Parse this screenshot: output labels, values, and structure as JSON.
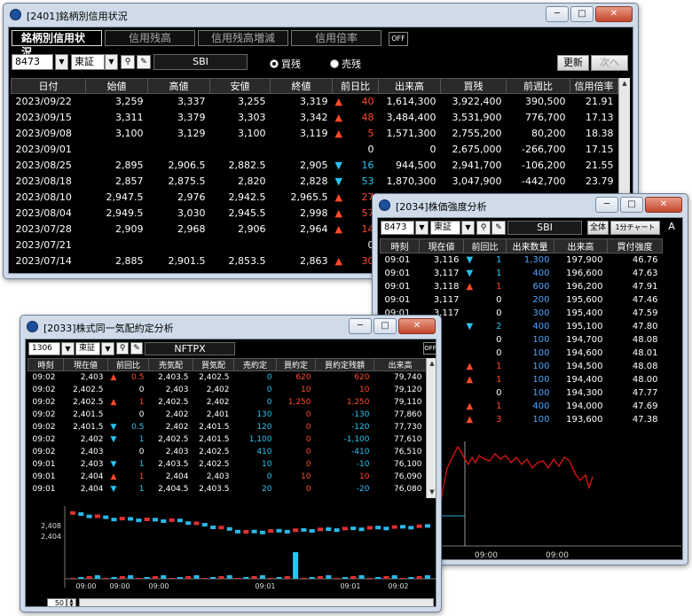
{
  "w1": {
    "title": "[2401]銘柄別信用状況",
    "tabs": [
      "銘柄別信用状況",
      "信用残高",
      "信用残高増減",
      "信用倍率"
    ],
    "off": "OFF",
    "code": "8473",
    "market": "東証",
    "name": "SBI",
    "radio_buy": "買残",
    "radio_sell": "売残",
    "btn_update": "更新",
    "btn_next": "次へ",
    "columns": [
      "日付",
      "始値",
      "高値",
      "安値",
      "終値",
      "前日比",
      "出来高",
      "買残",
      "前週比",
      "信用倍率"
    ],
    "rows": [
      [
        "2023/09/22",
        "3,259",
        "3,337",
        "3,255",
        "3,319",
        "up",
        "40",
        "1,614,300",
        "3,922,400",
        "390,500",
        "21.91"
      ],
      [
        "2023/09/15",
        "3,311",
        "3,379",
        "3,303",
        "3,342",
        "up",
        "48",
        "3,484,400",
        "3,531,900",
        "776,700",
        "17.13"
      ],
      [
        "2023/09/08",
        "3,100",
        "3,129",
        "3,100",
        "3,119",
        "up",
        "5",
        "1,571,300",
        "2,755,200",
        "80,200",
        "18.38"
      ],
      [
        "2023/09/01",
        "",
        "",
        "",
        "",
        "",
        "0",
        "0",
        "2,675,000",
        "-266,700",
        "17.15"
      ],
      [
        "2023/08/25",
        "2,895",
        "2,906.5",
        "2,882.5",
        "2,905",
        "dn",
        "16",
        "944,500",
        "2,941,700",
        "-106,200",
        "21.55"
      ],
      [
        "2023/08/18",
        "2,857",
        "2,875.5",
        "2,820",
        "2,828",
        "dn",
        "53",
        "1,870,300",
        "3,047,900",
        "-442,700",
        "23.79"
      ],
      [
        "2023/08/10",
        "2,947.5",
        "2,976",
        "2,942.5",
        "2,965.5",
        "up",
        "27",
        "",
        "",
        "",
        ""
      ],
      [
        "2023/08/04",
        "2,949.5",
        "3,030",
        "2,945.5",
        "2,998",
        "up",
        "57",
        "",
        "",
        "",
        ""
      ],
      [
        "2023/07/28",
        "2,909",
        "2,968",
        "2,906",
        "2,964",
        "up",
        "14",
        "",
        "",
        "",
        ""
      ],
      [
        "2023/07/21",
        "",
        "",
        "",
        "",
        "",
        "0",
        "",
        "",
        "",
        ""
      ],
      [
        "2023/07/14",
        "2,885",
        "2,901.5",
        "2,853.5",
        "2,863",
        "up",
        "30",
        "",
        "",
        "",
        ""
      ]
    ]
  },
  "w2": {
    "title": "[2034]株価強度分析",
    "code": "8473",
    "market": "東証",
    "name": "SBI",
    "btn_all": "全体",
    "btn_chart": "1分チャート",
    "letter": "A",
    "columns": [
      "時刻",
      "現在値",
      "前回比",
      "出来数量",
      "出来高",
      "買付強度"
    ],
    "rows": [
      [
        "09:01",
        "3,116",
        "dn",
        "1",
        "1,300",
        "197,900",
        "46.76"
      ],
      [
        "09:01",
        "3,117",
        "dn",
        "1",
        "400",
        "196,600",
        "47.63"
      ],
      [
        "09:01",
        "3,118",
        "up",
        "1",
        "600",
        "196,200",
        "47.91"
      ],
      [
        "09:01",
        "3,117",
        "",
        "0",
        "200",
        "195,600",
        "47.46"
      ],
      [
        "09:01",
        "3,117",
        "",
        "0",
        "300",
        "195,400",
        "47.59"
      ],
      [
        "09:01",
        "",
        "dn",
        "2",
        "400",
        "195,100",
        "47.80"
      ],
      [
        "09:01",
        "",
        "",
        "0",
        "100",
        "194,700",
        "48.08"
      ],
      [
        "09:01",
        "",
        "",
        "0",
        "100",
        "194,600",
        "48.01"
      ],
      [
        "09:01",
        "",
        "up",
        "1",
        "100",
        "194,500",
        "48.08"
      ],
      [
        "09:01",
        "",
        "up",
        "1",
        "100",
        "194,400",
        "48.00"
      ],
      [
        "09:01",
        "",
        "",
        "0",
        "100",
        "194,300",
        "47.77"
      ],
      [
        "09:01",
        "",
        "up",
        "1",
        "400",
        "194,000",
        "47.69"
      ],
      [
        "09:01",
        "",
        "up",
        "3",
        "100",
        "193,600",
        "47.38"
      ]
    ],
    "xticks": [
      "09:00",
      "09:00",
      "09:00"
    ]
  },
  "w3": {
    "title": "[2033]株式同一気配約定分析",
    "code": "1306",
    "market": "東証",
    "name": "NFTPX",
    "off": "OFF",
    "columns": [
      "時刻",
      "現在値",
      "前回比",
      "売気配",
      "買気配",
      "売約定",
      "買約定",
      "買約定残額",
      "出来高"
    ],
    "rows": [
      [
        "09:02",
        "2,403",
        "up",
        "0.5",
        "2,403.5",
        "2,402.5",
        "0",
        "620",
        "620",
        "79,740"
      ],
      [
        "09:02",
        "2,402.5",
        "",
        "0",
        "2,403",
        "2,402",
        "0",
        "10",
        "10",
        "79,120"
      ],
      [
        "09:02",
        "2,402.5",
        "up",
        "1",
        "2,402.5",
        "2,402",
        "0",
        "1,250",
        "1,250",
        "79,110"
      ],
      [
        "09:02",
        "2,401.5",
        "",
        "0",
        "2,402",
        "2,401",
        "130",
        "0",
        "-130",
        "77,860"
      ],
      [
        "09:02",
        "2,401.5",
        "dn",
        "0.5",
        "2,402",
        "2,401.5",
        "120",
        "0",
        "-120",
        "77,730"
      ],
      [
        "09:02",
        "2,402",
        "dn",
        "1",
        "2,402.5",
        "2,401.5",
        "1,100",
        "0",
        "-1,100",
        "77,610"
      ],
      [
        "09:02",
        "2,403",
        "",
        "0",
        "2,403",
        "2,402.5",
        "410",
        "0",
        "-410",
        "76,510"
      ],
      [
        "09:01",
        "2,403",
        "dn",
        "1",
        "2,403.5",
        "2,402.5",
        "10",
        "0",
        "-10",
        "76,100"
      ],
      [
        "09:01",
        "2,404",
        "up",
        "1",
        "2,404",
        "2,403",
        "0",
        "10",
        "10",
        "76,090"
      ],
      [
        "09:01",
        "2,404",
        "dn",
        "1",
        "2,404.5",
        "2,403.5",
        "20",
        "0",
        "-20",
        "76,080"
      ]
    ],
    "yticks": [
      "2,408",
      "2,404"
    ],
    "xticks": [
      "09:00",
      "09:00",
      "09:00",
      "09:01",
      "09:01",
      "09:02"
    ],
    "spin_value": "50"
  }
}
